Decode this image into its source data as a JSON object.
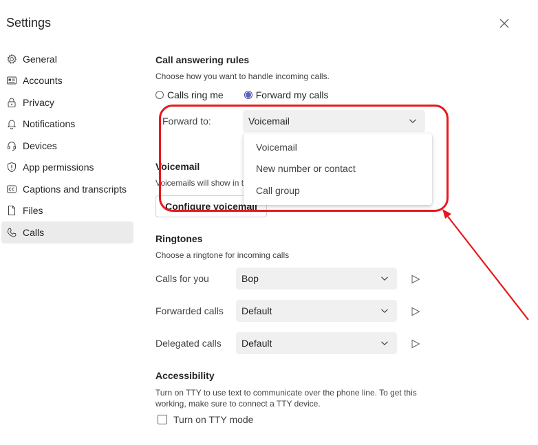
{
  "window": {
    "title": "Settings"
  },
  "sidebar": {
    "items": [
      {
        "label": "General",
        "icon": "gear-icon"
      },
      {
        "label": "Accounts",
        "icon": "id-card-icon"
      },
      {
        "label": "Privacy",
        "icon": "lock-icon"
      },
      {
        "label": "Notifications",
        "icon": "bell-icon"
      },
      {
        "label": "Devices",
        "icon": "headset-icon"
      },
      {
        "label": "App permissions",
        "icon": "shield-icon"
      },
      {
        "label": "Captions and transcripts",
        "icon": "cc-icon"
      },
      {
        "label": "Files",
        "icon": "file-icon"
      },
      {
        "label": "Calls",
        "icon": "phone-icon"
      }
    ],
    "active": "Calls"
  },
  "call_answering": {
    "title": "Call answering rules",
    "description": "Choose how you want to handle incoming calls.",
    "option_ring": "Calls ring me",
    "option_forward": "Forward my calls",
    "selected_option": "Forward my calls",
    "forward_to_label": "Forward to:",
    "forward_to_value": "Voicemail",
    "dropdown_options": [
      "Voicemail",
      "New number or contact",
      "Call group"
    ]
  },
  "voicemail": {
    "title": "Voicemail",
    "description": "Voicemails will show in th",
    "button_label": "Configure voicemail"
  },
  "ringtones": {
    "title": "Ringtones",
    "description": "Choose a ringtone for incoming calls",
    "rows": [
      {
        "label": "Calls for you",
        "value": "Bop"
      },
      {
        "label": "Forwarded calls",
        "value": "Default"
      },
      {
        "label": "Delegated calls",
        "value": "Default"
      }
    ]
  },
  "accessibility": {
    "title": "Accessibility",
    "description_line1": "Turn on TTY to use text to communicate over the phone line. To get this",
    "description_line2": "working, make sure to connect a TTY device.",
    "tty_label": "Turn on TTY mode",
    "tty_checked": false
  },
  "annotation": {
    "color": "#e8171d"
  },
  "colors": {
    "accent": "#5b5fc7",
    "active_nav": "#ebebeb",
    "select_bg": "#f0f0f0"
  }
}
